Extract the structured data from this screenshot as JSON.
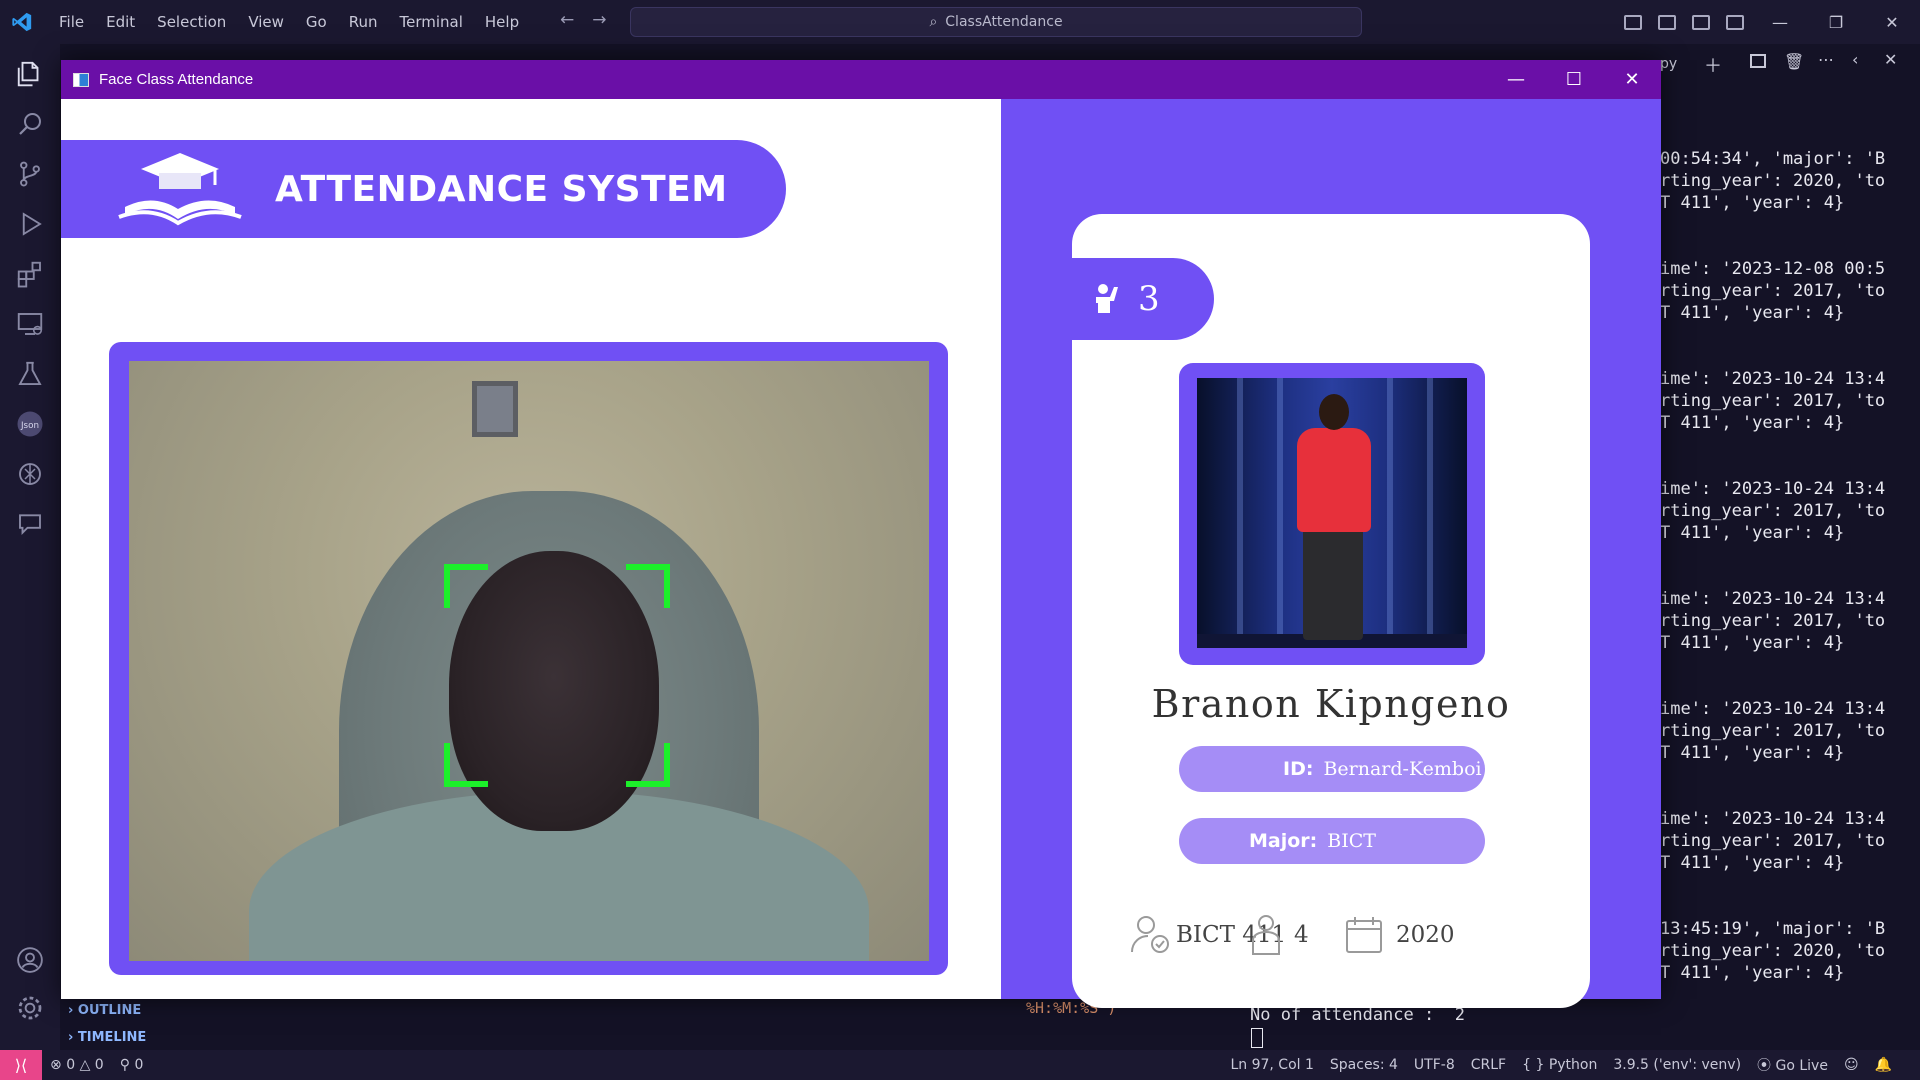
{
  "vscode": {
    "menu": [
      "File",
      "Edit",
      "Selection",
      "View",
      "Go",
      "Run",
      "Terminal",
      "Help"
    ],
    "command_center": "ClassAttendance",
    "outline_label": "OUTLINE",
    "timeline_label": "TIMELINE",
    "code_fragment": "%H:%M:%S\")",
    "terminal_lines": [
      [
        "00:54:34', 'major': 'B",
        "rting_year': 2020, 'to",
        "T 411', 'year': 4}"
      ],
      [
        "ime': '2023-12-08 00:5",
        "rting_year': 2017, 'to",
        "T 411', 'year': 4}"
      ],
      [
        "ime': '2023-10-24 13:4",
        "rting_year': 2017, 'to",
        "T 411', 'year': 4}"
      ],
      [
        "ime': '2023-10-24 13:4",
        "rting_year': 2017, 'to",
        "T 411', 'year': 4}"
      ],
      [
        "ime': '2023-10-24 13:4",
        "rting_year': 2017, 'to",
        "T 411', 'year': 4}"
      ],
      [
        "ime': '2023-10-24 13:4",
        "rting_year': 2017, 'to",
        "T 411', 'year': 4}"
      ],
      [
        "ime': '2023-10-24 13:4",
        "rting_year': 2017, 'to",
        "T 411', 'year': 4}"
      ],
      [
        "13:45:19', 'major': 'B",
        "rting_year': 2020, 'to",
        "T 411', 'year': 4}"
      ]
    ],
    "attendance_output": "No of attendance :  2",
    "editor_tab_fragment": "py",
    "status": {
      "errors": "0",
      "warnings": "0",
      "ports": "0",
      "position": "Ln 97, Col 1",
      "spaces": "Spaces: 4",
      "encoding": "UTF-8",
      "eol": "CRLF",
      "language": "Python",
      "interpreter": "3.9.5 ('env': venv)",
      "go_live": "Go Live"
    }
  },
  "app": {
    "window_title": "Face Class Attendance",
    "header_title": "ATTENDANCE SYSTEM",
    "attendance_count": "3",
    "student": {
      "name": "Branon Kipngeno",
      "id_label": "ID:",
      "id_value": "Bernard-Kemboi",
      "major_label": "Major:",
      "major_value": "BICT",
      "class": "BICT 411",
      "year": "4",
      "starting_year": "2020"
    },
    "colors": {
      "accent": "#7050f4",
      "pill": "#a58df6",
      "titlebar": "#6a0fa7",
      "face_box": "#1cf02a"
    }
  }
}
